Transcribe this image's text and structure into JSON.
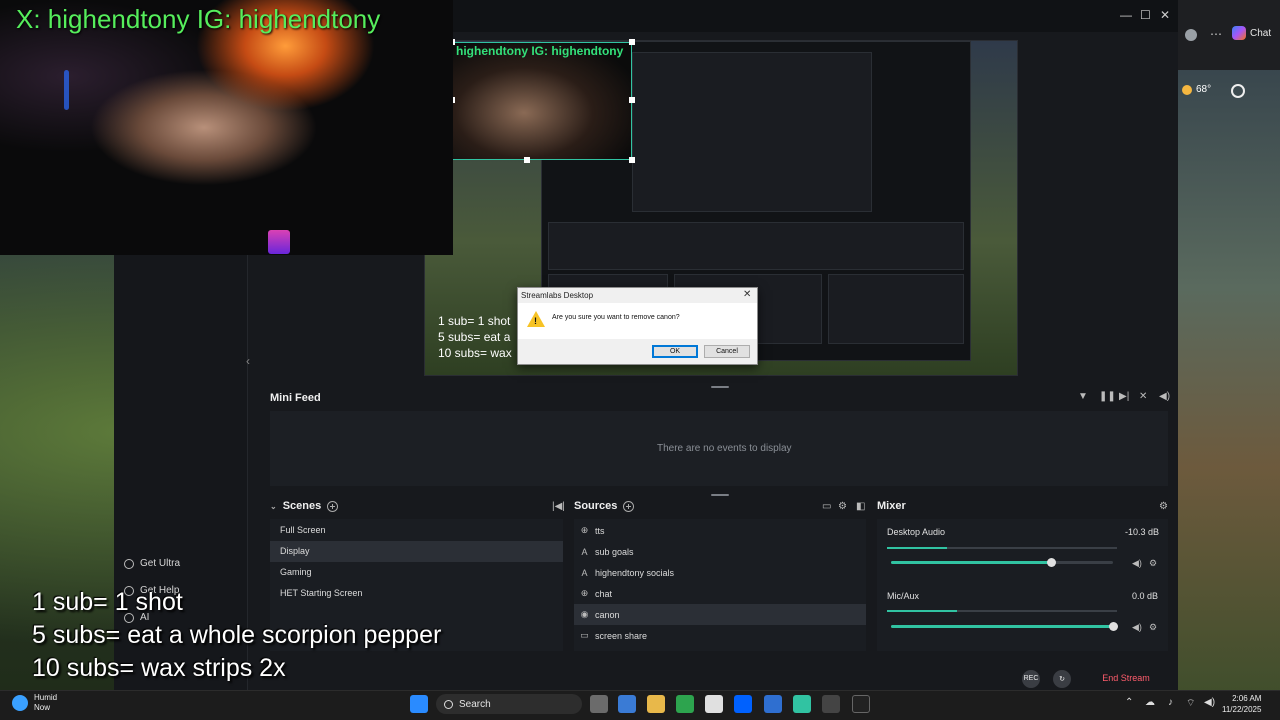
{
  "browser": {
    "chat_label": "Chat",
    "weather_temp": "68°"
  },
  "overlay": {
    "handle_text": "X: highendtony IG: highendtony",
    "rules": [
      "1 sub= 1 shot",
      "5 subs= eat a whole scorpion pepper",
      "10 subs= wax strips 2x"
    ]
  },
  "preview": {
    "cam_handle": "highendtony IG: highendtony",
    "sub_lines": [
      "1 sub= 1 shot",
      "5 subs= eat a",
      "10 subs= wax"
    ]
  },
  "sidebar": {
    "get_ultra": "Get Ultra",
    "get_help": "Get Help",
    "ai": "AI"
  },
  "dialog": {
    "title": "Streamlabs Desktop",
    "message": "Are you sure you want to remove canon?",
    "ok_label": "OK",
    "cancel_label": "Cancel"
  },
  "mini_feed": {
    "title": "Mini Feed",
    "empty_text": "There are no events to display"
  },
  "scenes": {
    "title": "Scenes",
    "items": [
      {
        "label": "Full Screen",
        "active": false
      },
      {
        "label": "Display",
        "active": true
      },
      {
        "label": "Gaming",
        "active": false
      },
      {
        "label": "HET Starting Screen",
        "active": false
      }
    ]
  },
  "sources": {
    "title": "Sources",
    "items": [
      {
        "label": "tts",
        "icon": "globe-icon",
        "active": false
      },
      {
        "label": "sub goals",
        "icon": "text-icon",
        "active": false
      },
      {
        "label": "highendtony socials",
        "icon": "text-icon",
        "active": false
      },
      {
        "label": "chat",
        "icon": "globe-icon",
        "active": false
      },
      {
        "label": "canon",
        "icon": "camera-icon",
        "active": true
      },
      {
        "label": "screen share",
        "icon": "monitor-icon",
        "active": false
      }
    ]
  },
  "mixer": {
    "title": "Mixer",
    "channels": [
      {
        "name": "Desktop Audio",
        "db": "-10.3 dB",
        "level": 0.72
      },
      {
        "name": "Mic/Aux",
        "db": "0.0 dB",
        "level": 1.0
      }
    ]
  },
  "footer": {
    "end_stream": "End Stream",
    "rec_label": "REC"
  },
  "taskbar": {
    "weather_title": "Humid",
    "weather_sub": "Now",
    "search_label": "Search",
    "time": "2:06 AM",
    "date": "11/22/2025"
  },
  "colors": {
    "accent": "#31c3a2",
    "end_stream": "#ff5c6c",
    "overlay_green": "#56ee5c"
  }
}
